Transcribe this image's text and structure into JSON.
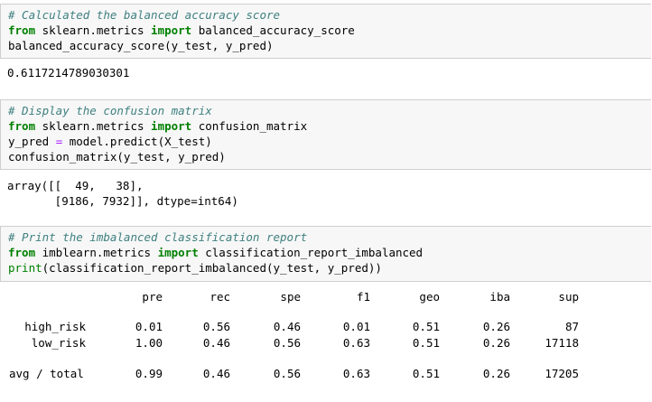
{
  "cells": [
    {
      "lines": [
        [
          {
            "t": "# Calculated the balanced accuracy score",
            "c": "cmt"
          }
        ],
        [
          {
            "t": "from",
            "c": "kw"
          },
          {
            "t": " sklearn.metrics ",
            "c": ""
          },
          {
            "t": "import",
            "c": "kw"
          },
          {
            "t": " balanced_accuracy_score",
            "c": ""
          }
        ],
        [
          {
            "t": "balanced_accuracy_score(y_test, y_pred)",
            "c": ""
          }
        ]
      ],
      "output": [
        "0.6117214789030301"
      ]
    },
    {
      "lines": [
        [
          {
            "t": "# Display the confusion matrix",
            "c": "cmt"
          }
        ],
        [
          {
            "t": "from",
            "c": "kw"
          },
          {
            "t": " sklearn.metrics ",
            "c": ""
          },
          {
            "t": "import",
            "c": "kw"
          },
          {
            "t": " confusion_matrix",
            "c": ""
          }
        ],
        [
          {
            "t": "y_pred ",
            "c": ""
          },
          {
            "t": "=",
            "c": "op"
          },
          {
            "t": " model.predict(X_test)",
            "c": ""
          }
        ],
        [
          {
            "t": "confusion_matrix(y_test, y_pred)",
            "c": ""
          }
        ]
      ],
      "output": [
        "array([[  49,   38],",
        "       [9186, 7932]], dtype=int64)"
      ]
    },
    {
      "lines": [
        [
          {
            "t": "# Print the imbalanced classification report",
            "c": "cmt"
          }
        ],
        [
          {
            "t": "from",
            "c": "kw"
          },
          {
            "t": " imblearn.metrics ",
            "c": ""
          },
          {
            "t": "import",
            "c": "kw"
          },
          {
            "t": " classification_report_imbalanced",
            "c": ""
          }
        ],
        [
          {
            "t": "print",
            "c": "bi"
          },
          {
            "t": "(classification_report_imbalanced(y_test, y_pred))",
            "c": ""
          }
        ]
      ]
    }
  ],
  "report": {
    "headers": [
      "pre",
      "rec",
      "spe",
      "f1",
      "geo",
      "iba",
      "sup"
    ],
    "rows": [
      {
        "label": "high_risk",
        "values": [
          "0.01",
          "0.56",
          "0.46",
          "0.01",
          "0.51",
          "0.26",
          "87"
        ]
      },
      {
        "label": "low_risk",
        "values": [
          "1.00",
          "0.46",
          "0.56",
          "0.63",
          "0.51",
          "0.26",
          "17118"
        ]
      }
    ],
    "total": {
      "label": "avg / total",
      "values": [
        "0.99",
        "0.46",
        "0.56",
        "0.63",
        "0.51",
        "0.26",
        "17205"
      ]
    }
  }
}
